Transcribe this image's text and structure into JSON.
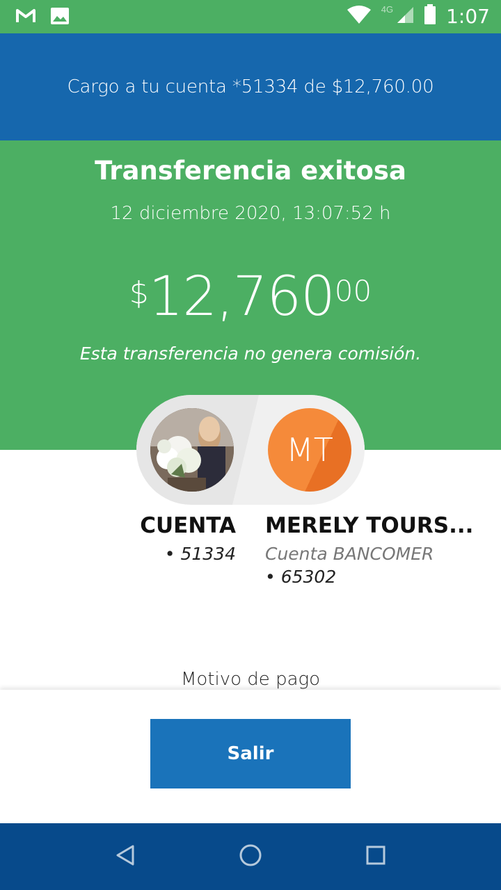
{
  "status_bar": {
    "time": "1:07",
    "network_label": "4G",
    "icons": [
      "gmail-icon",
      "gallery-icon",
      "wifi-icon",
      "signal-icon",
      "battery-icon"
    ]
  },
  "header": {
    "charge_text": "Cargo a tu cuenta *51334 de $12,760.00"
  },
  "confirmation": {
    "title": "Transferencia exitosa",
    "datetime": "12 diciembre 2020, 13:07:52 h",
    "amount_currency": "$",
    "amount_main": "12,760",
    "amount_cents": "00",
    "commission_note": "Esta transferencia no genera comisión."
  },
  "source_account": {
    "name": "CUENTA",
    "number": "• 51334"
  },
  "destination_account": {
    "initials": "MT",
    "name": "MERELY TOURS...",
    "bank": "Cuenta BANCOMER",
    "number": "• 65302"
  },
  "payment_reason_label": "Motivo de pago",
  "actions": {
    "exit_label": "Salir"
  },
  "colors": {
    "success_green": "#4caf63",
    "header_blue": "#1667ad",
    "button_blue": "#1a73ba",
    "nav_blue": "#074a8b",
    "avatar_orange": "#f58a3a"
  }
}
